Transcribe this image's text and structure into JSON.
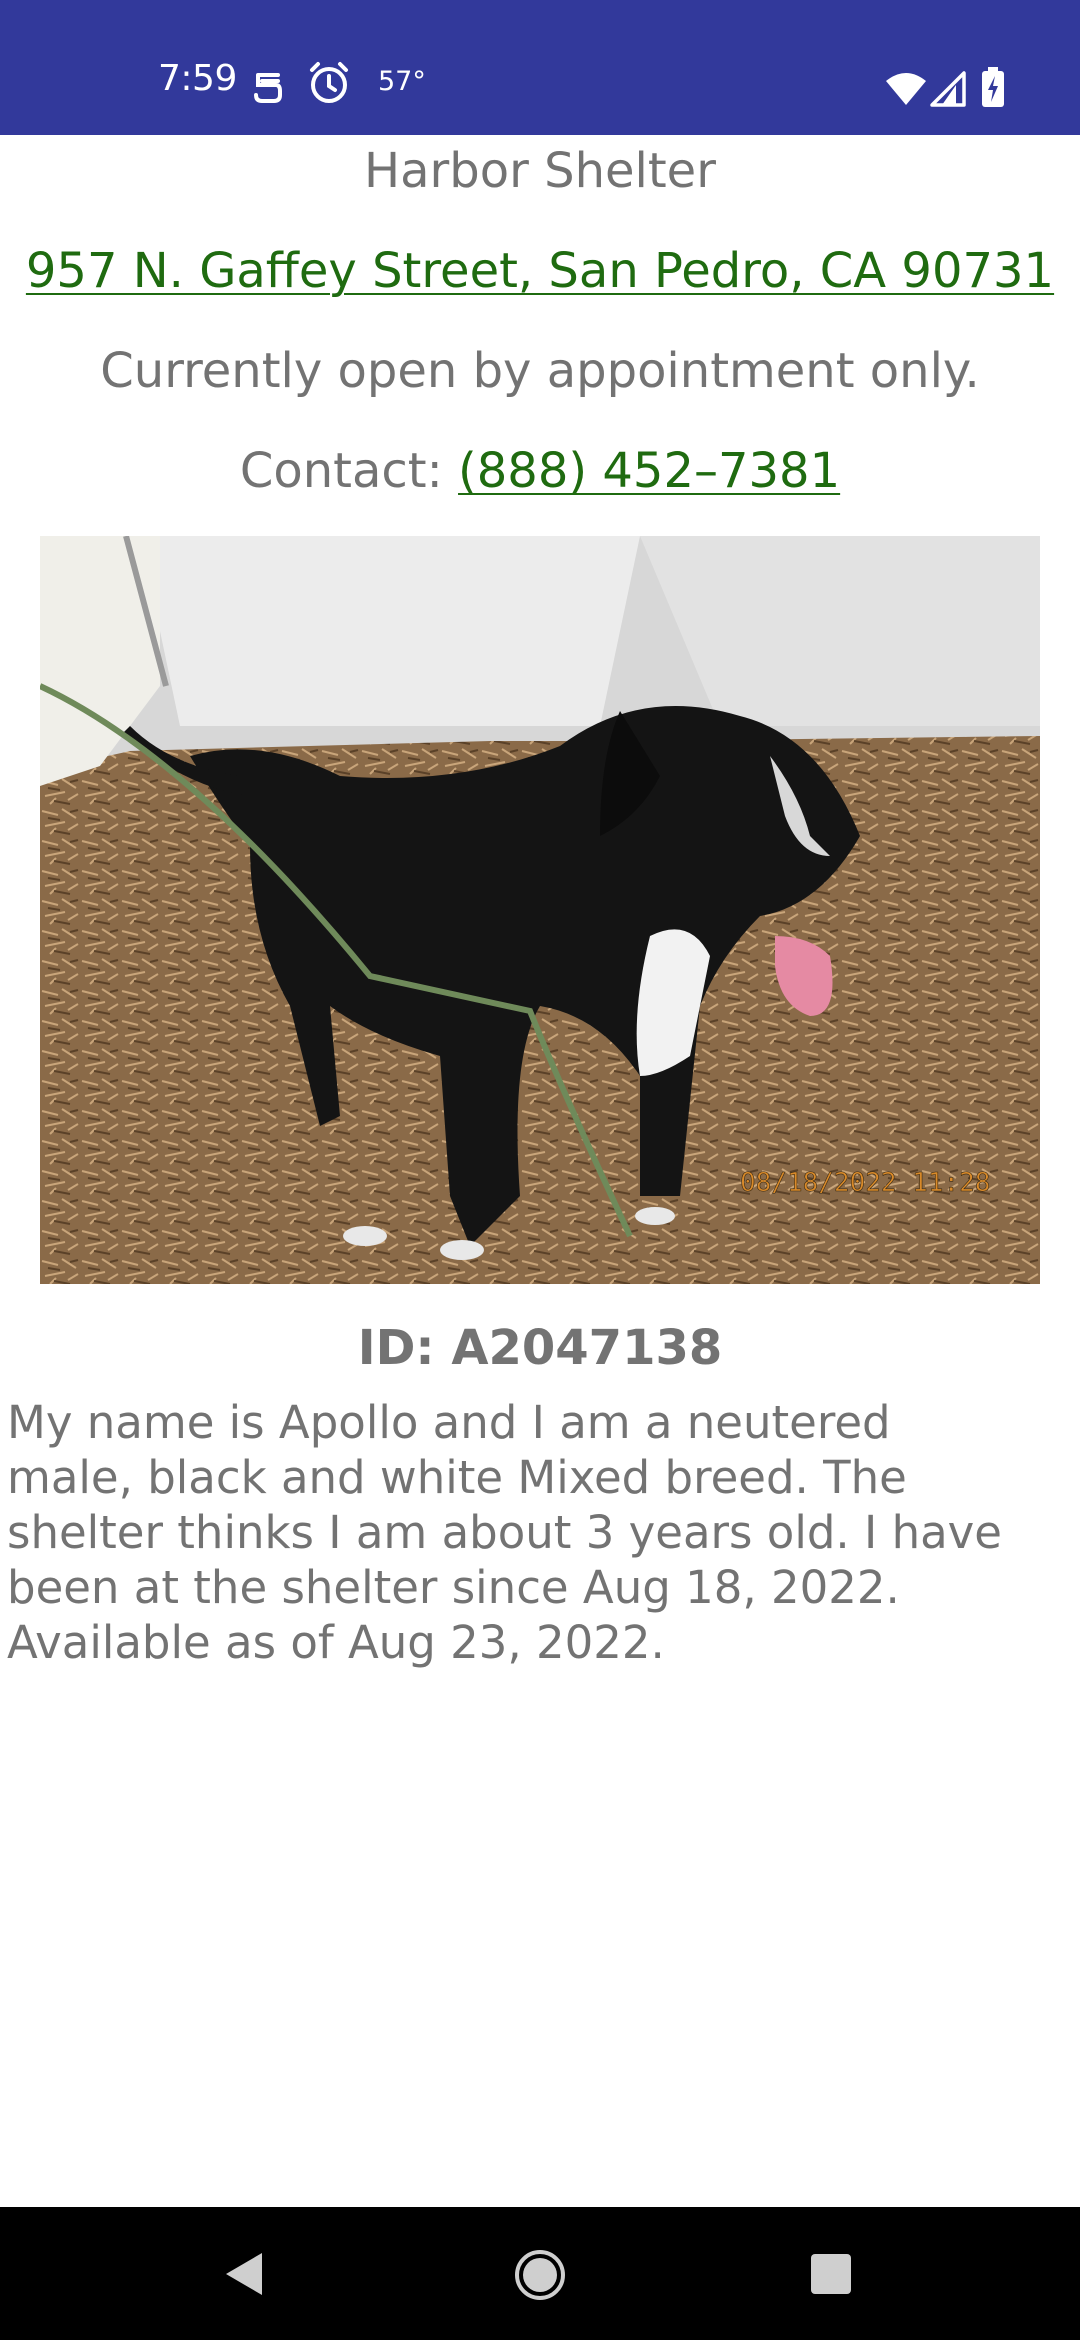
{
  "status_bar": {
    "time": "7:59",
    "temperature": "57°",
    "background_color": "#32399b",
    "left_icons": [
      "badge-icon",
      "alarm-icon"
    ],
    "right_icons": [
      "wifi-icon",
      "cell-signal-icon",
      "battery-charging-icon"
    ]
  },
  "shelter": {
    "name": "Harbor Shelter",
    "address": "957 N. Gaffey Street, San Pedro, CA 90731",
    "hours_note": "Currently open by appointment only.",
    "contact_label": "Contact: ",
    "contact_phone": "(888) 452–7381",
    "link_color": "#1f6b10"
  },
  "animal": {
    "photo_timestamp": "08/18/2022  11:28",
    "id_text": "ID: A2047138",
    "description": "My name is Apollo and I am a neutered male, black and white Mixed breed. The shelter thinks I am about 3 years old. I have been at the shelter since Aug 18, 2022. Available as of Aug 23, 2022."
  },
  "nav_bar": {
    "buttons": [
      "back-icon",
      "home-icon",
      "recents-icon"
    ]
  }
}
